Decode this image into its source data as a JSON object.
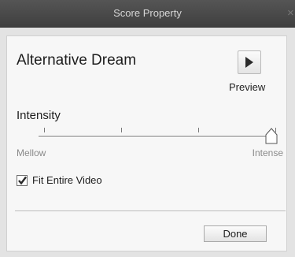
{
  "window": {
    "title": "Score Property",
    "close_glyph": "×"
  },
  "score": {
    "name": "Alternative Dream"
  },
  "preview": {
    "label": "Preview",
    "icon": "play-icon"
  },
  "intensity": {
    "label": "Intensity",
    "min_label": "Mellow",
    "max_label": "Intense",
    "value_fraction": 1.0,
    "tick_count": 4
  },
  "fit_entire_video": {
    "label": "Fit Entire Video",
    "checked": true
  },
  "done": {
    "label": "Done"
  },
  "colors": {
    "titlebar": "#4a4a4a",
    "panel": "#f7f7f7",
    "window": "#e3e3e3"
  }
}
